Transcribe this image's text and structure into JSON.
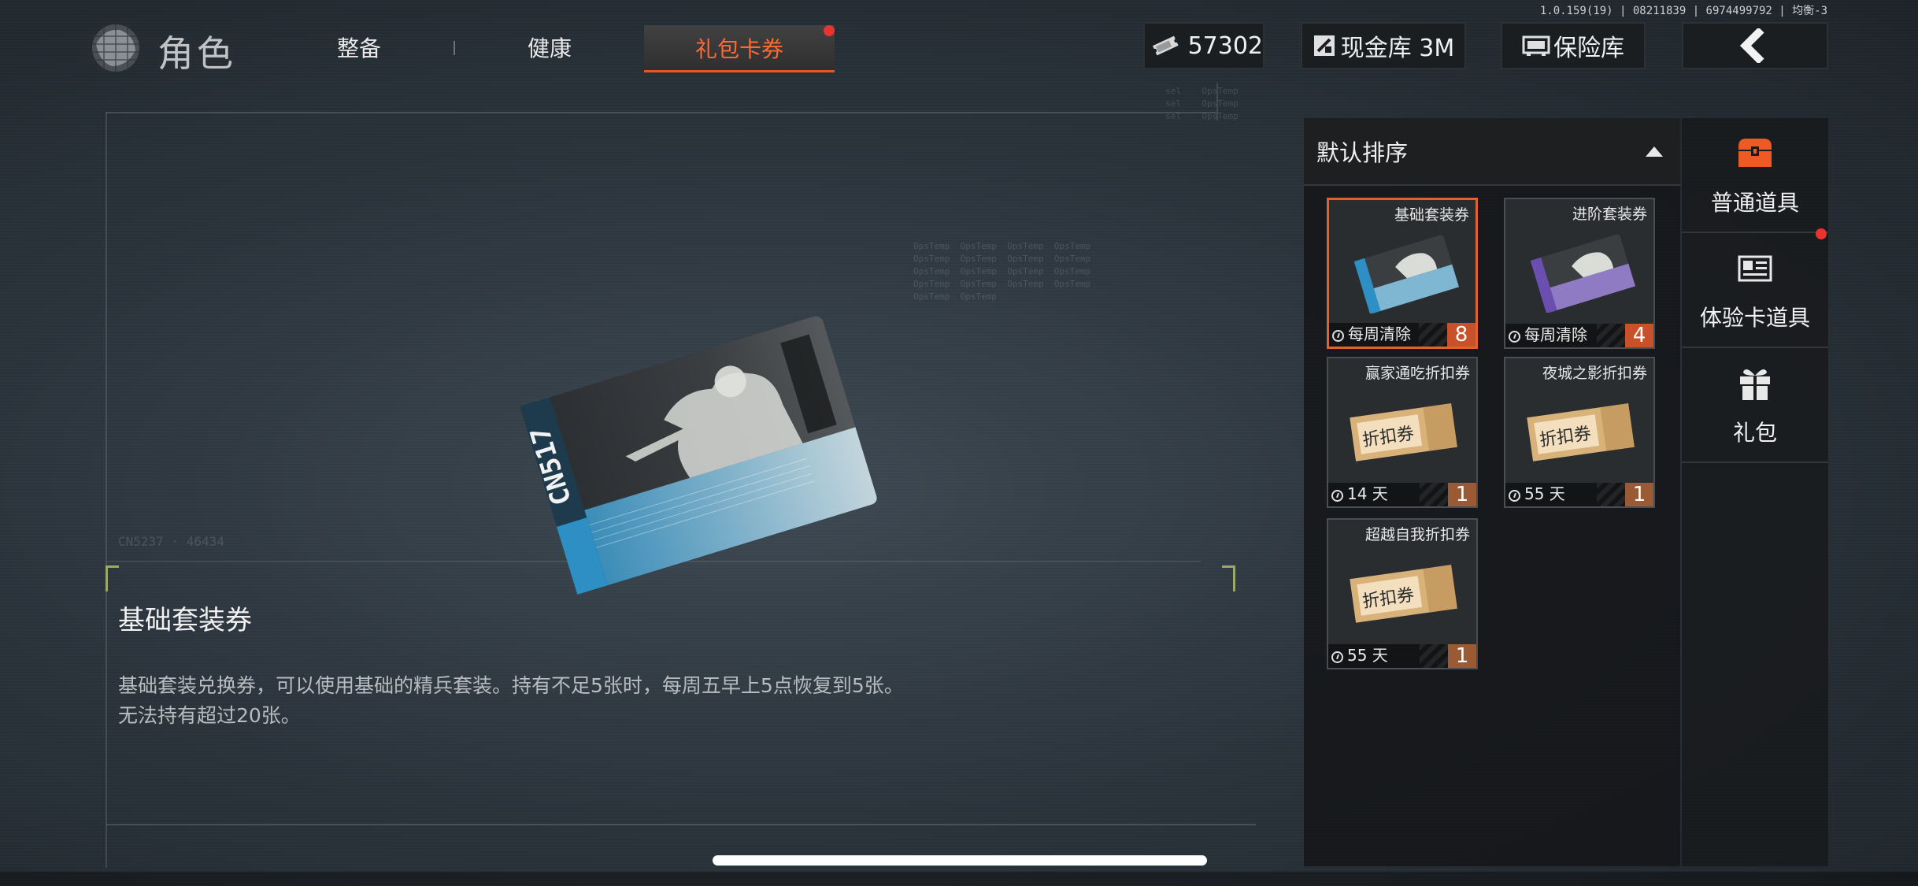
{
  "status": {
    "version": "1.0.159(19) | 08211839 | 6974499792 | 均衡-3"
  },
  "header": {
    "title": "角色",
    "tabs": [
      {
        "label": "整备",
        "active": false
      },
      {
        "label": "健康",
        "active": false
      },
      {
        "label": "礼包卡券",
        "active": true,
        "has_notification": true
      }
    ],
    "currency": {
      "value": "57302",
      "icon": "ticket-icon"
    },
    "cash_vault": {
      "label": "现金库 3M",
      "icon": "cash-vault-icon"
    },
    "safe_box": {
      "label": "保险库",
      "icon": "safe-box-icon"
    },
    "back": {
      "icon": "chevron-left-icon"
    }
  },
  "detail": {
    "name": "基础套装券",
    "description_line1": "基础套装兑换券，可以使用基础的精兵套装。持有不足5张时，每周五早上5点恢复到5张。",
    "description_line2": "无法持有超过20张。",
    "card_text": "CN517"
  },
  "inventory": {
    "sort_label": "默认排序",
    "items": [
      {
        "name": "基础套装券",
        "expiry": "每周清除",
        "count": "8",
        "thumb": "blue-ticket",
        "selected": true
      },
      {
        "name": "进阶套装券",
        "expiry": "每周清除",
        "count": "4",
        "thumb": "purple-ticket",
        "selected": false
      },
      {
        "name": "赢家通吃折扣券",
        "expiry": "14 天",
        "count": "1",
        "thumb": "discount-ticket",
        "selected": false
      },
      {
        "name": "夜城之影折扣券",
        "expiry": "55 天",
        "count": "1",
        "thumb": "discount-ticket",
        "selected": false
      },
      {
        "name": "超越自我折扣券",
        "expiry": "55 天",
        "count": "1",
        "thumb": "discount-ticket",
        "selected": false
      }
    ],
    "discount_label": "折扣券"
  },
  "categories": [
    {
      "label": "普通道具",
      "icon": "treasure-chest-icon",
      "active": true
    },
    {
      "label": "体验卡道具",
      "icon": "id-card-icon",
      "has_notification": true
    },
    {
      "label": "礼包",
      "icon": "gift-icon"
    }
  ],
  "colors": {
    "accent": "#e2562a",
    "panel": "#141618",
    "notification": "#e8332f"
  }
}
